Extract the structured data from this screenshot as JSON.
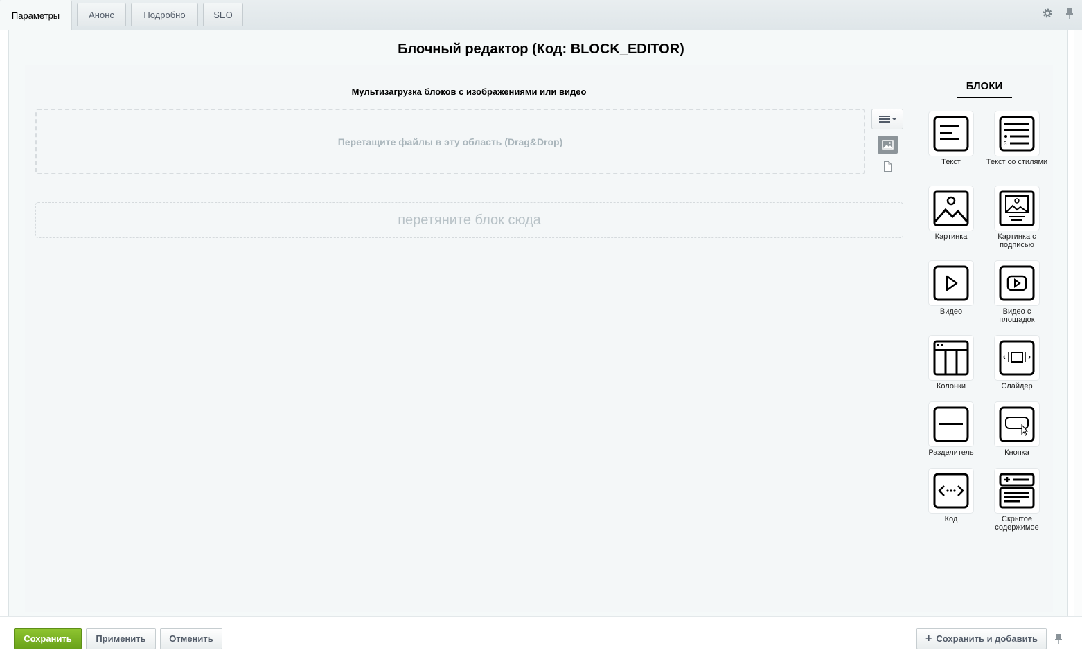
{
  "tabs": [
    {
      "label": "Параметры",
      "active": true
    },
    {
      "label": "Анонс",
      "active": false
    },
    {
      "label": "Подробно",
      "active": false
    },
    {
      "label": "SEO",
      "active": false
    }
  ],
  "toolbar_icons": [
    "gear-icon",
    "pin-icon"
  ],
  "editor": {
    "title": "Блочный редактор (Код: BLOCK_EDITOR)",
    "upload_title": "Мультизагрузка блоков с изображениями или видео",
    "dropzone_text": "Перетащите файлы в эту область (Drag&Drop)",
    "block_drop_text": "перетяните блок сюда"
  },
  "blocks_panel": {
    "title": "БЛОКИ",
    "items": [
      {
        "label": "Текст",
        "icon": "text-icon"
      },
      {
        "label": "Текст со стилями",
        "icon": "styled-text-icon"
      },
      {
        "label": "Картинка",
        "icon": "image-icon"
      },
      {
        "label": "Картинка с подписью",
        "icon": "image-caption-icon"
      },
      {
        "label": "Видео",
        "icon": "video-icon"
      },
      {
        "label": "Видео с площадок",
        "icon": "video-platform-icon"
      },
      {
        "label": "Колонки",
        "icon": "columns-icon"
      },
      {
        "label": "Слайдер",
        "icon": "slider-icon"
      },
      {
        "label": "Разделитель",
        "icon": "divider-icon"
      },
      {
        "label": "Кнопка",
        "icon": "button-icon"
      },
      {
        "label": "Код",
        "icon": "code-icon"
      },
      {
        "label": "Скрытое содержимое",
        "icon": "hidden-content-icon"
      }
    ]
  },
  "footer": {
    "save": "Сохранить",
    "apply": "Применить",
    "cancel": "Отменить",
    "save_and_add": "Сохранить и добавить"
  },
  "colors": {
    "save_button": "#7bb326",
    "panel_background": "#f5f9f9",
    "dropzone_text": "#a9b5bb"
  }
}
